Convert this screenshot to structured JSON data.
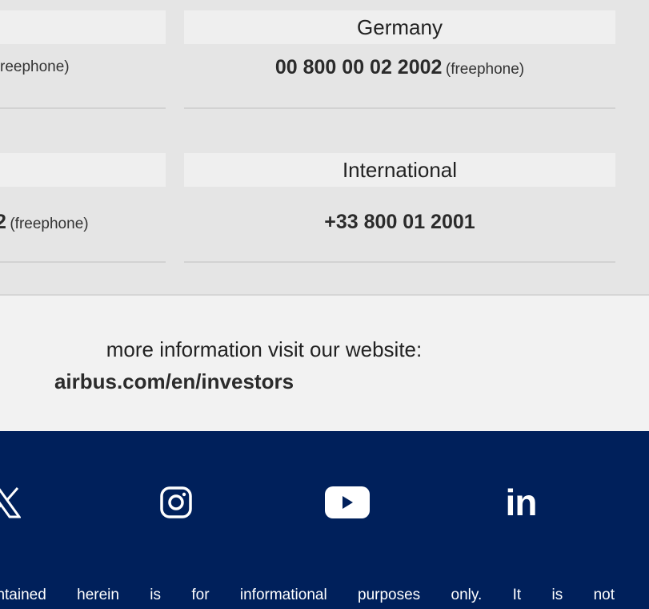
{
  "contacts": {
    "top_left": {
      "label": "",
      "phone": "",
      "note": "reephone)"
    },
    "top_right": {
      "label": "Germany",
      "phone": "00 800 00 02 2002",
      "note": "(freephone)"
    },
    "bottom_left": {
      "label": "",
      "phone": "2",
      "note": "(freephone)"
    },
    "bottom_right": {
      "label": "International",
      "phone": "+33 800 01 2001",
      "note": ""
    }
  },
  "info": {
    "line1": "more information visit our website:",
    "link": "airbus.com/en/investors"
  },
  "footer": {
    "social": [
      {
        "icon": "x-icon"
      },
      {
        "icon": "instagram-icon"
      },
      {
        "icon": "youtube-icon"
      },
      {
        "icon": "linkedin-icon",
        "text": "in"
      }
    ],
    "disclaimer": "mation contained herein is for informational purposes only. It is not"
  },
  "colors": {
    "footer_bg": "#00205b",
    "contacts_bg": "#e5e5e5",
    "cell_head_bg": "#efefef",
    "info_bg": "#f2f2f2",
    "white": "#ffffff"
  }
}
